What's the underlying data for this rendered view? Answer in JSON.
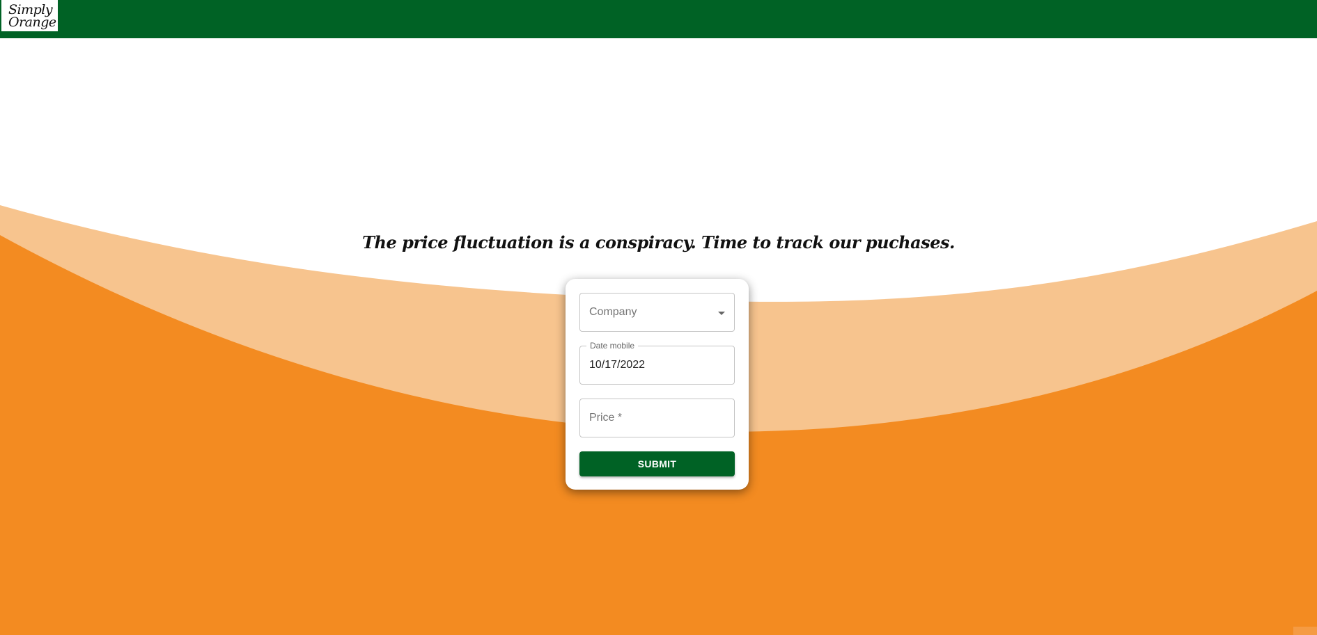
{
  "header": {
    "logo_line1": "Simply",
    "logo_line2": "Orange"
  },
  "main": {
    "tagline": "The price fluctuation is a conspiracy. Time to track our puchases."
  },
  "form": {
    "company_placeholder": "Company",
    "date_label": "Date mobile",
    "date_value": "10/17/2022",
    "price_placeholder": "Price *",
    "submit_label": "SUBMIT"
  },
  "colors": {
    "header_green": "#006225",
    "orange": "#f38b21",
    "light_orange": "#f7c48e",
    "white": "#ffffff"
  },
  "icons": {
    "company_dropdown": "caret-down-icon"
  }
}
